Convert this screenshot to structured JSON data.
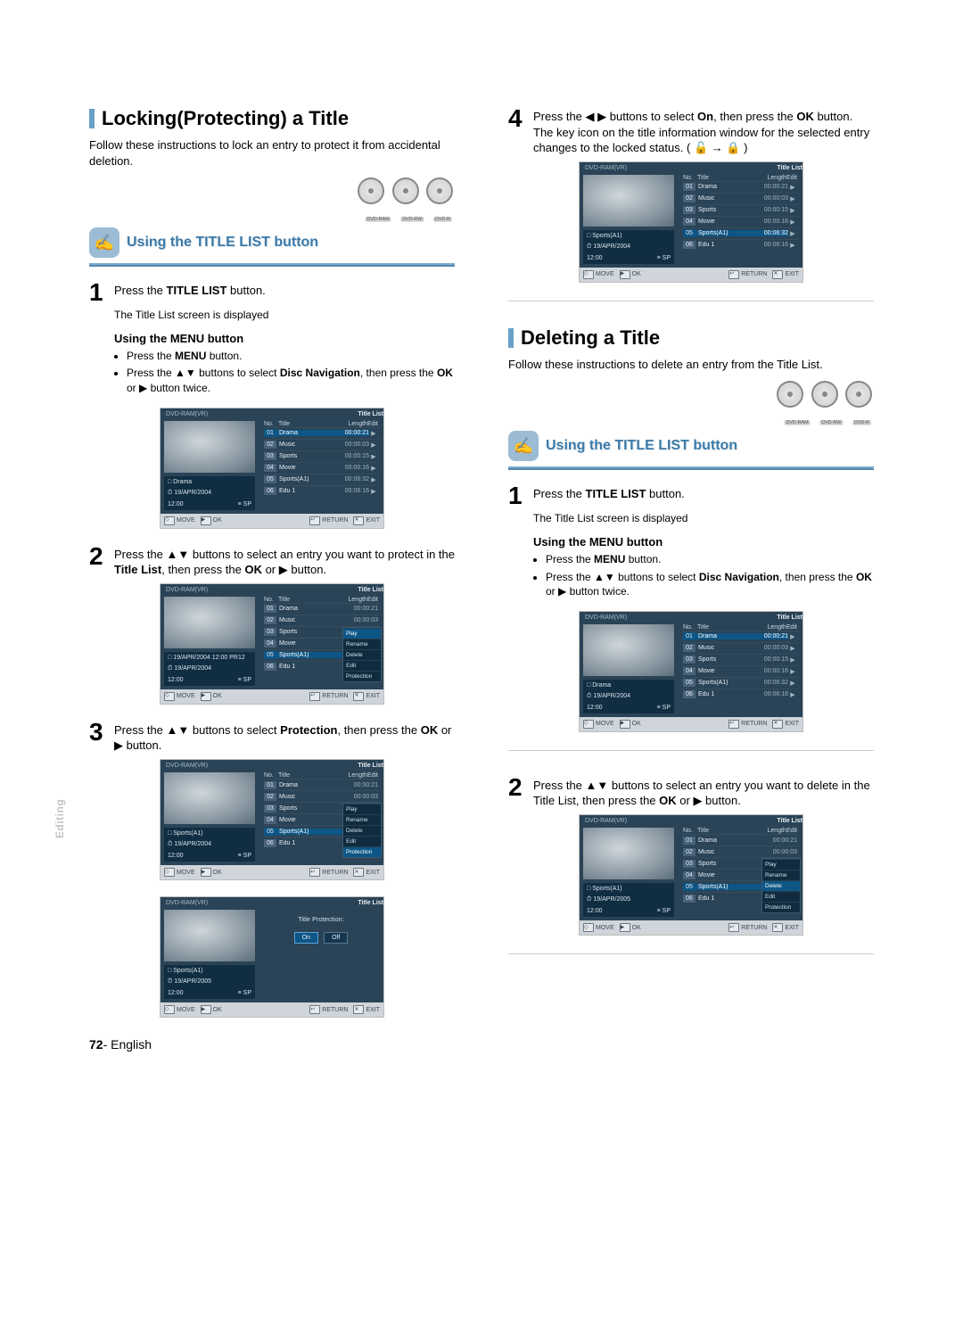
{
  "page": {
    "number": "72",
    "lang_label": "English",
    "side_label": "Editing"
  },
  "disc_labels": [
    "DVD-RAM",
    "DVD-RW",
    "DVD-R"
  ],
  "sub_heading": "Using the TITLE LIST button",
  "step_title_list": {
    "line": "Press the TITLE LIST button.",
    "sub": "The Title List screen is displayed"
  },
  "menu_sub": {
    "heading": "Using the MENU button",
    "b1": "Press the MENU button.",
    "b2": "Press the ▲▼ buttons to select Disc Navigation, then press the OK or ▶ button twice."
  },
  "locking": {
    "title": "Locking(Protecting) a Title",
    "intro": "Follow these instructions to lock an entry to protect it from accidental deletion.",
    "step2": "Press the ▲▼ buttons to select an entry you want to protect in the Title List, then press the OK or ▶ button.",
    "step3": "Press the ▲▼ buttons to select Protection, then press the OK or ▶ button.",
    "step4": "Press the ◀ ▶ buttons to select On, then press the OK button. The key icon on the title information window for the selected entry changes to the locked status. ( 🔓 → 🔒 )"
  },
  "deleting": {
    "title": "Deleting a Title",
    "intro": "Follow these instructions to delete an entry from the Title List.",
    "step2": "Press the ▲▼ buttons to select an entry you want to delete in the Title List, then press the OK or ▶ button."
  },
  "tl": {
    "mode": "DVD-RAM(VR)",
    "screen_label": "Title List",
    "footer": {
      "move": "MOVE",
      "ok": "OK",
      "return": "RETURN",
      "exit": "EXIT"
    },
    "hdr": {
      "no": "No.",
      "title": "Title",
      "length": "Length",
      "edit": "Edit"
    },
    "rows": [
      {
        "no": "01",
        "title": "Drama",
        "length": "00:00:21",
        "edit": "▶"
      },
      {
        "no": "02",
        "title": "Music",
        "length": "00:00:03",
        "edit": "▶"
      },
      {
        "no": "03",
        "title": "Sports",
        "length": "00:00:15",
        "edit": "▶"
      },
      {
        "no": "04",
        "title": "Movie",
        "length": "00:00:16",
        "edit": "▶"
      },
      {
        "no": "05",
        "title": "Sports(A1)",
        "length": "00:06:32",
        "edit": "▶"
      },
      {
        "no": "06",
        "title": "Edu 1",
        "length": "00:06:16",
        "edit": "▶"
      }
    ],
    "context": [
      "Play",
      "Rename",
      "Delete",
      "Edit",
      "Protection"
    ],
    "dialog_label": "Title Protection:",
    "dialog_on": "On",
    "dialog_off": "Off",
    "info1_date_full": "19/APR/2004 12:00 PR12",
    "info1": {
      "name": "Drama",
      "date": "19/APR/2004",
      "time": "12:00",
      "rec": "SP"
    },
    "info2": {
      "name": "Sports(A1)",
      "date": "19/APR/2004",
      "time": "12:00",
      "rec": "SP"
    },
    "info2b": {
      "name": "Sports(A1)",
      "date": "19/APR/2005",
      "time": "12:00",
      "rec": "SP"
    }
  }
}
